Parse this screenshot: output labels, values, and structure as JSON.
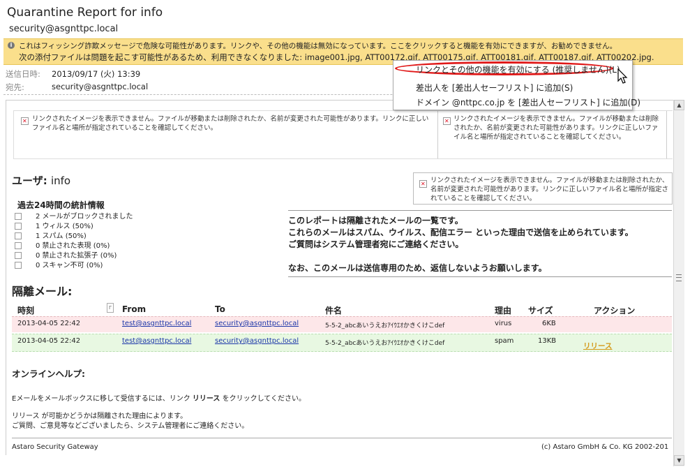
{
  "header": {
    "title": "Quarantine Report for info",
    "sender": "security@asgnttpc.local"
  },
  "warning": {
    "line1": "これはフィッシング詐欺メッセージで危険な可能性があります。リンクや、その他の機能は無効になっています。ここをクリックすると機能を有効にできますが、お勧めできません。",
    "line2": "次の添付ファイルは問題を起こす可能性があるため、利用できなくなりました: image001.jpg, ATT00172.gif, ATT00175.gif, ATT00181.gif, ATT00187.gif, ATT00202.jpg."
  },
  "meta": {
    "sent_label": "送信日時:",
    "sent_value": "2013/09/17 (火) 13:39",
    "to_label": "宛先:",
    "to_value": "security@asgnttpc.local"
  },
  "context_menu": {
    "items": [
      "リンクとその他の機能を有効にする (推奨しません)(L)",
      "差出人を [差出人セーフリスト] に追加(S)",
      "ドメイン @nttpc.co.jp を [差出人セーフリスト] に追加(D)"
    ]
  },
  "broken_image": {
    "text1": "リンクされたイメージを表示できません。ファイルが移動または削除されたか、名前が変更された可能性があります。リンクに正しいファイル名と場所が指定されていることを確認してください。",
    "text2": "リンクされたイメージを表示できません。ファイルが移動または削除されたか、名前が変更された可能性があります。リンクに正しいファイル名と場所が指定されていることを確認してください。",
    "text3": "リンクされたイメージを表示できません。ファイルが移動または削除されたか、名前が変更された可能性があります。リンクに正しいファイル名と場所が指定されていることを確認してください。"
  },
  "user": {
    "label": "ユーザ:",
    "name": "info"
  },
  "stats": {
    "title": "過去24時間の統計情報",
    "items": [
      "2 メールがブロックされました",
      "1 ウィルス (50%)",
      "1 スパム (50%)",
      "0 禁止された表現 (0%)",
      "0 禁止された拡張子 (0%)",
      "0 スキャン不可 (0%)"
    ]
  },
  "notice": {
    "line1": "このレポートは隔離されたメールの一覧です。",
    "line2": "これらのメールはスパム、ウイルス、配信エラー といった理由で送信を止められています。",
    "line3": "ご質問はシステム管理者宛にご連絡ください。",
    "line4": "なお、このメールは送信専用のため、返信しないようお願いします。"
  },
  "quarantine": {
    "title": "隔離メール:",
    "columns": [
      "時刻",
      "From",
      "To",
      "件名",
      "理由",
      "サイズ",
      "アクション"
    ],
    "rows": [
      {
        "time": "2013-04-05 22:42",
        "from": "test@asgnttpc.local",
        "to": "security@asgnttpc.local",
        "subject": "5-5-2_abcあいうえおｱｲｳｴｵかきくけこdef",
        "reason": "virus",
        "size": "6KB",
        "action": ""
      },
      {
        "time": "2013-04-05 22:42",
        "from": "test@asgnttpc.local",
        "to": "security@asgnttpc.local",
        "subject": "5-5-2_abcあいうえおｱｲｳｴｵかきくけこdef",
        "reason": "spam",
        "size": "13KB",
        "action": "リリース"
      }
    ]
  },
  "help": {
    "title": "オンラインヘルプ:",
    "line1_pre": "Eメールをメールボックスに移して受信するには、リンク",
    "line1_bold": "リリース",
    "line1_post": "をクリックしてください。",
    "line2": "リリース が可能かどうかは隔離された理由によります。",
    "line3": "ご質問、ご意見等などございましたら、システム管理者にご連絡ください。"
  },
  "footer": {
    "left": "Astaro Security Gateway",
    "right": "(c) Astaro GmbH & Co. KG 2002-201"
  }
}
